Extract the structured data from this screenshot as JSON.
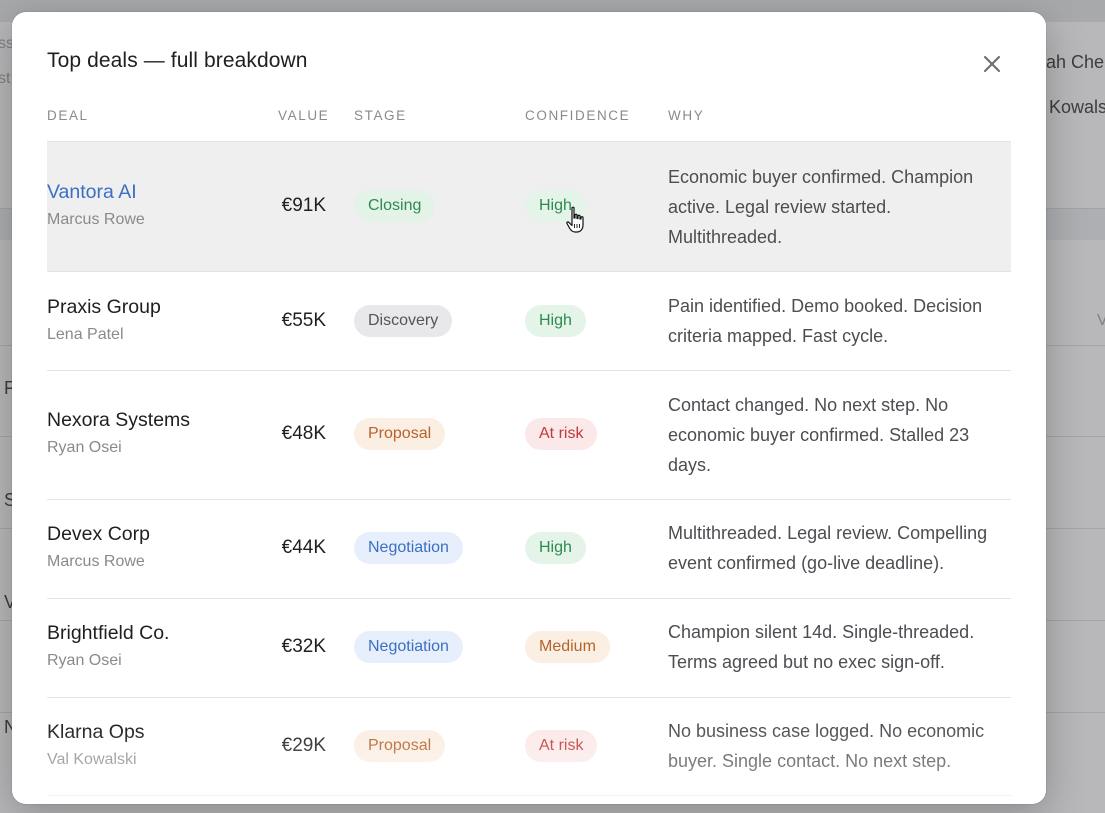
{
  "background": {
    "right_names": [
      "rah Che",
      "l Kowals"
    ],
    "left_fragments": [
      "ss",
      "st",
      "F",
      "S",
      "V",
      "N"
    ],
    "right_col": "V"
  },
  "modal": {
    "title": "Top deals — full breakdown",
    "close_icon": "close-icon",
    "columns": {
      "deal": "DEAL",
      "value": "VALUE",
      "stage": "STAGE",
      "confidence": "CONFIDENCE",
      "why": "WHY"
    },
    "rows": [
      {
        "name": "Vantora AI",
        "owner": "Marcus Rowe",
        "value": "€91K",
        "stage": "Closing",
        "confidence": "High",
        "why": "Economic buyer confirmed. Champion active. Legal review started. Multithreaded."
      },
      {
        "name": "Praxis Group",
        "owner": "Lena Patel",
        "value": "€55K",
        "stage": "Discovery",
        "confidence": "High",
        "why": "Pain identified. Demo booked. Decision criteria mapped. Fast cycle."
      },
      {
        "name": "Nexora Systems",
        "owner": "Ryan Osei",
        "value": "€48K",
        "stage": "Proposal",
        "confidence": "At risk",
        "why": "Contact changed. No next step. No economic buyer confirmed. Stalled 23 days."
      },
      {
        "name": "Devex Corp",
        "owner": "Marcus Rowe",
        "value": "€44K",
        "stage": "Negotiation",
        "confidence": "High",
        "why": "Multithreaded. Legal review. Compelling event confirmed (go-live deadline)."
      },
      {
        "name": "Brightfield Co.",
        "owner": "Ryan Osei",
        "value": "€32K",
        "stage": "Negotiation",
        "confidence": "Medium",
        "why": "Champion silent 14d. Single-threaded. Terms agreed but no exec sign-off."
      },
      {
        "name": "Klarna Ops",
        "owner": "Val Kowalski",
        "value": "€29K",
        "stage": "Proposal",
        "confidence": "At risk",
        "why": "No business case logged. No economic buyer. Single contact. No next step."
      }
    ]
  },
  "colors": {
    "link": "#3b6fc4",
    "stage": {
      "Closing": {
        "bg": "#e3f3e8",
        "fg": "#2e8b4f"
      },
      "Discovery": {
        "bg": "#e8e8ea",
        "fg": "#55555a"
      },
      "Proposal": {
        "bg": "#fbeee3",
        "fg": "#b5642a"
      },
      "Negotiation": {
        "bg": "#e6effb",
        "fg": "#3b6fc4"
      }
    },
    "confidence": {
      "High": {
        "bg": "#e4f4e9",
        "fg": "#2e8b4f"
      },
      "At risk": {
        "bg": "#fbe9e9",
        "fg": "#c03a3a"
      },
      "Medium": {
        "bg": "#fbeee3",
        "fg": "#b5642a"
      }
    }
  }
}
